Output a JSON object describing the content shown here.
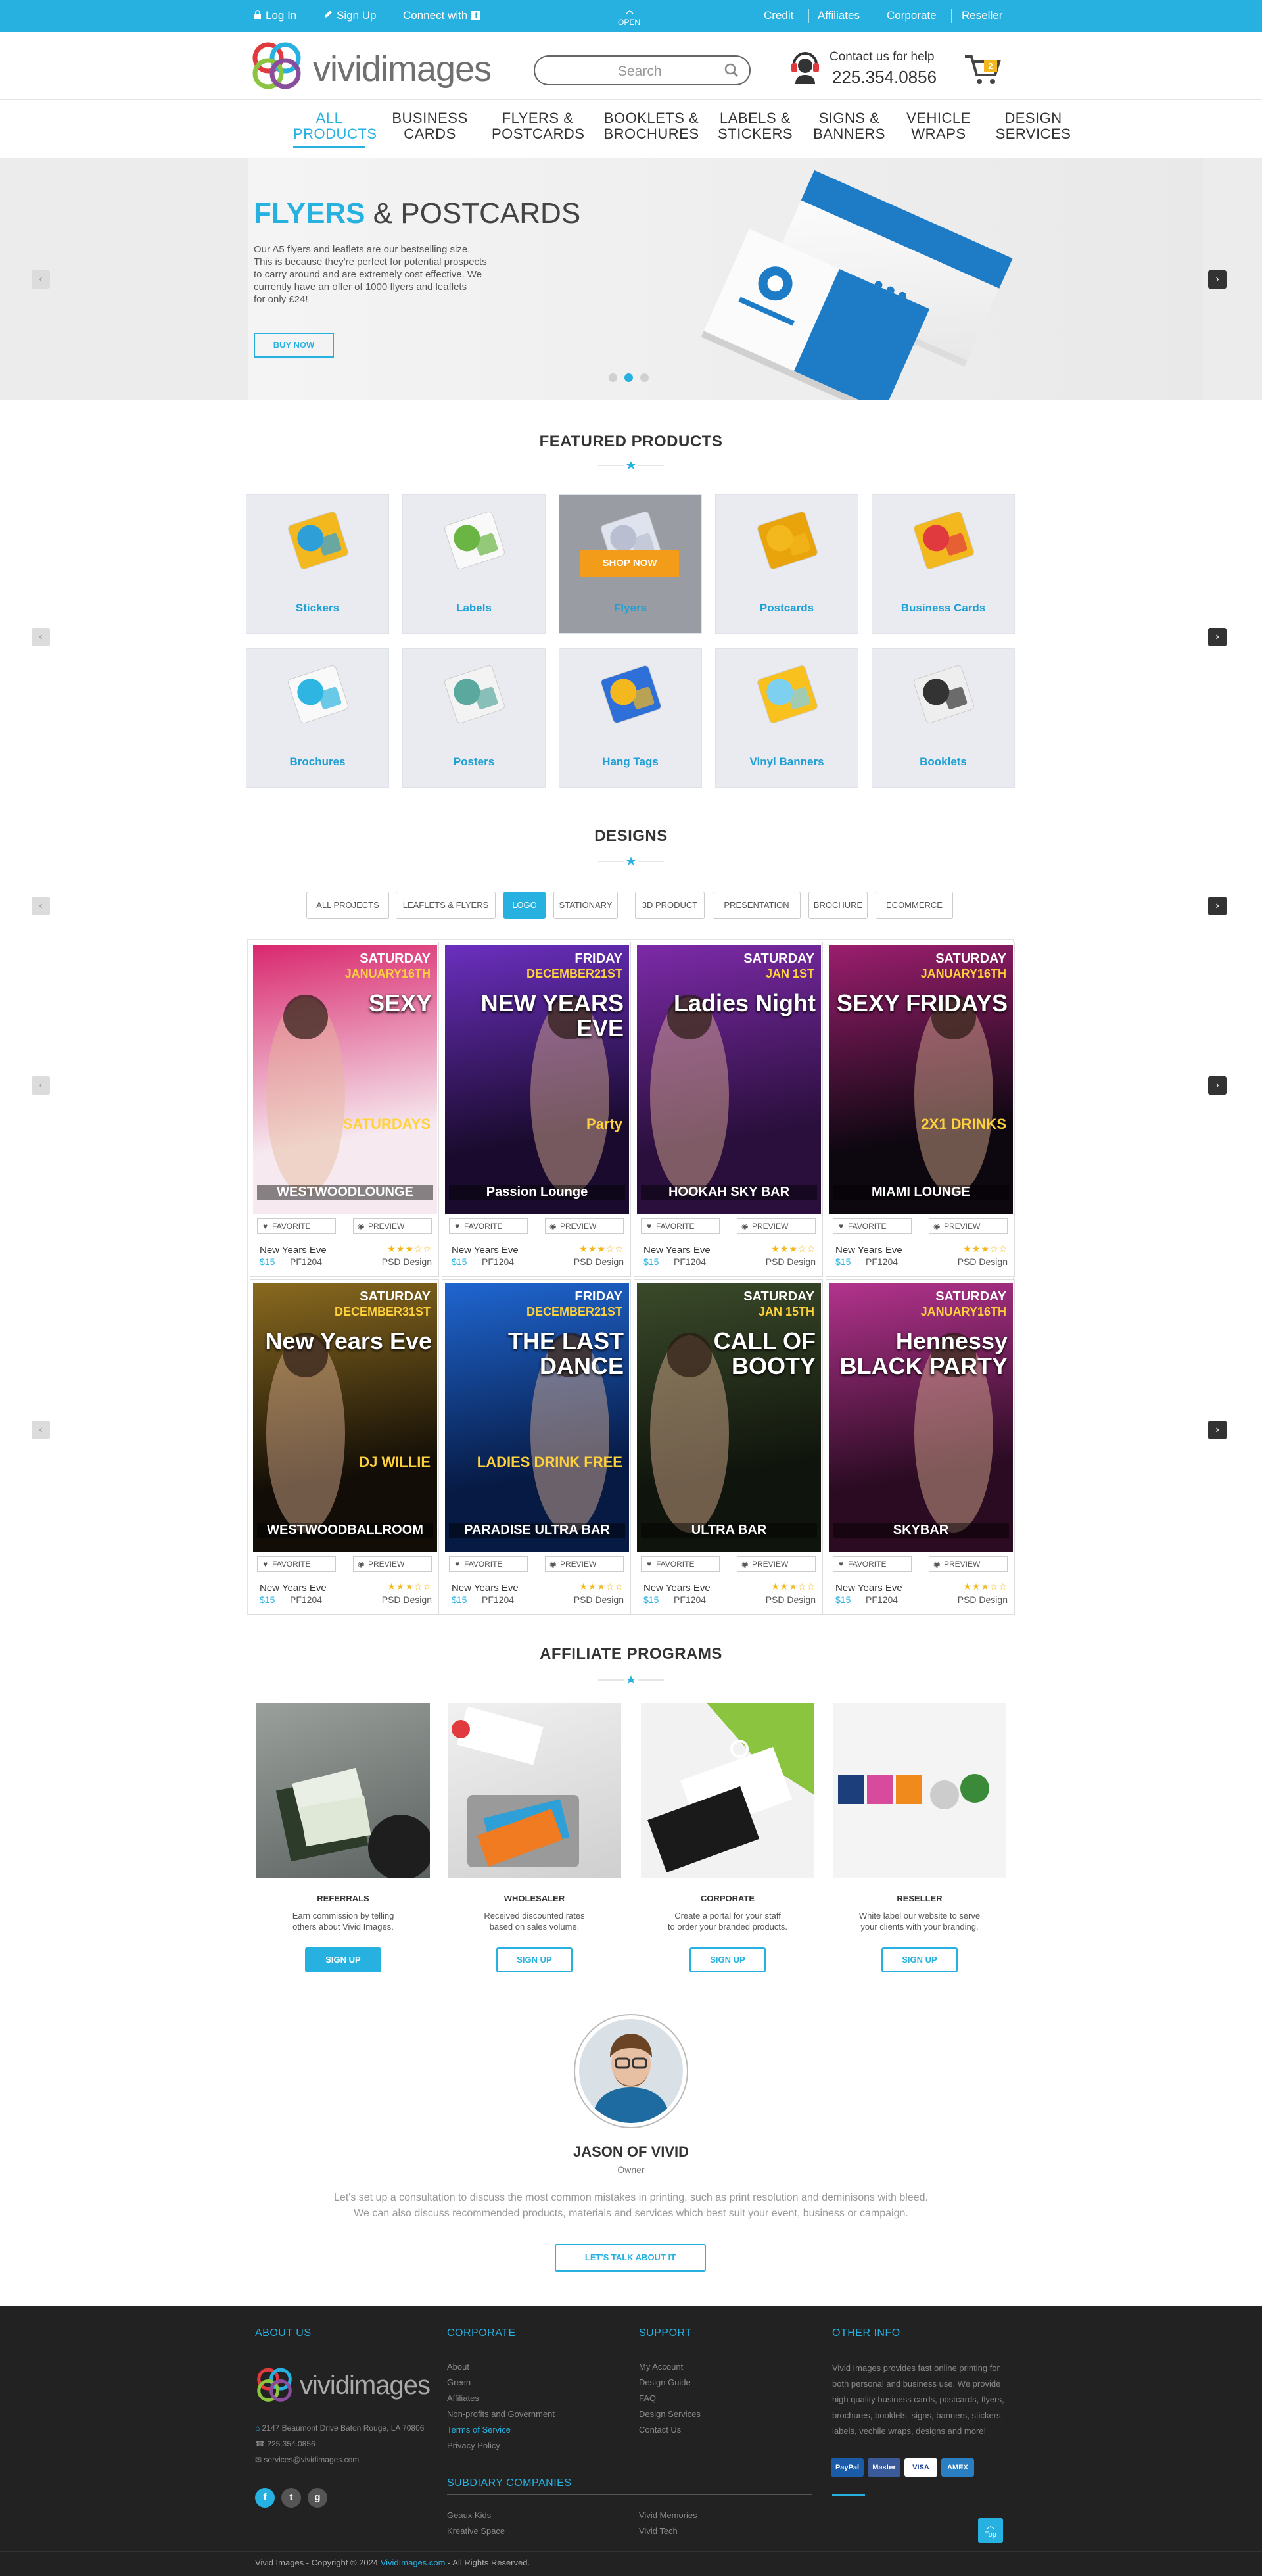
{
  "topbar": {
    "login": "Log In",
    "signup": "Sign Up",
    "connect": "Connect with",
    "open_tab": "OPEN",
    "links": [
      "Credit",
      "Affiliates",
      "Corporate",
      "Reseller"
    ]
  },
  "header": {
    "logo_text": "vividimages",
    "search_placeholder": "Search",
    "contact_label": "Contact us for help",
    "phone": "225.354.0856",
    "cart_count": "2"
  },
  "nav": [
    {
      "line1": "ALL",
      "line2": "PRODUCTS",
      "active": true
    },
    {
      "line1": "BUSINESS",
      "line2": "CARDS"
    },
    {
      "line1": "FLYERS &",
      "line2": "POSTCARDS"
    },
    {
      "line1": "BOOKLETS &",
      "line2": "BROCHURES"
    },
    {
      "line1": "LABELS &",
      "line2": "STICKERS"
    },
    {
      "line1": "SIGNS &",
      "line2": "BANNERS"
    },
    {
      "line1": "VEHICLE",
      "line2": "WRAPS"
    },
    {
      "line1": "DESIGN",
      "line2": "SERVICES"
    }
  ],
  "hero": {
    "title_bold": "FLYERS",
    "title_light": "& POSTCARDS",
    "body_lines": [
      "Our A5 flyers and leaflets are our bestselling size.",
      "This is because they're perfect for potential prospects",
      "to carry around and are extremely cost effective. We",
      "currently have an offer of 1000 flyers and leaflets",
      "for only £24!"
    ],
    "cta": "BUY NOW",
    "slides": 3,
    "active_slide": 2
  },
  "featured": {
    "title": "FEATURED PRODUCTS",
    "shop_now": "SHOP NOW",
    "items": [
      "Stickers",
      "Labels",
      "Flyers",
      "Postcards",
      "Business Cards",
      "Brochures",
      "Posters",
      "Hang Tags",
      "Vinyl Banners",
      "Booklets"
    ]
  },
  "designs": {
    "title": "DESIGNS",
    "filters": [
      "ALL PROJECTS",
      "LEAFLETS & FLYERS",
      "LOGO",
      "STATIONARY",
      "3D PRODUCT",
      "PRESENTATION",
      "BROCHURE",
      "ECOMMERCE"
    ],
    "active_filter": "LOGO",
    "favorite_label": "FAVORITE",
    "preview_label": "PREVIEW",
    "cards": [
      {
        "name": "New Years Eve",
        "price": "$15",
        "code": "PF1204",
        "type": "PSD Design",
        "poster": {
          "top": "SATURDAY",
          "mid": "JANUARY16TH",
          "big": "SEXY",
          "sub": "SATURDAYS",
          "foot": "WESTWOODLOUNGE",
          "c1": "#f6e9ef",
          "c2": "#d9286e"
        }
      },
      {
        "name": "New Years Eve",
        "price": "$15",
        "code": "PF1204",
        "type": "PSD Design",
        "poster": {
          "top": "FRIDAY",
          "mid": "DECEMBER21ST",
          "big": "NEW YEARS EVE",
          "sub": "Party",
          "foot": "Passion Lounge",
          "c1": "#1a0b2e",
          "c2": "#6b2fbf"
        }
      },
      {
        "name": "New Years Eve",
        "price": "$15",
        "code": "PF1204",
        "type": "PSD Design",
        "poster": {
          "top": "SATURDAY",
          "mid": "JAN 1ST",
          "big": "Ladies Night",
          "sub": "",
          "foot": "HOOKAH SKY BAR",
          "c1": "#2a0f3c",
          "c2": "#7c2aa8"
        }
      },
      {
        "name": "New Years Eve",
        "price": "$15",
        "code": "PF1204",
        "type": "PSD Design",
        "poster": {
          "top": "SATURDAY",
          "mid": "JANUARY16TH",
          "big": "SEXY FRIDAYS",
          "sub": "2X1 DRINKS",
          "foot": "MIAMI LOUNGE",
          "c1": "#0d0710",
          "c2": "#9b1e6e"
        }
      },
      {
        "name": "New Years Eve",
        "price": "$15",
        "code": "PF1204",
        "type": "PSD Design",
        "poster": {
          "top": "SATURDAY",
          "mid": "DECEMBER31ST",
          "big": "New Years Eve",
          "sub": "DJ WILLIE",
          "foot": "WESTWOODBALLROOM",
          "c1": "#120d06",
          "c2": "#8a6a1f"
        }
      },
      {
        "name": "New Years Eve",
        "price": "$15",
        "code": "PF1204",
        "type": "PSD Design",
        "poster": {
          "top": "FRIDAY",
          "mid": "DECEMBER21ST",
          "big": "THE LAST DANCE",
          "sub": "LADIES DRINK FREE",
          "foot": "PARADISE ULTRA BAR",
          "c1": "#071a44",
          "c2": "#1f66d1"
        }
      },
      {
        "name": "New Years Eve",
        "price": "$15",
        "code": "PF1204",
        "type": "PSD Design",
        "poster": {
          "top": "SATURDAY",
          "mid": "JAN 15TH",
          "big": "CALL OF BOOTY",
          "sub": "",
          "foot": "ULTRA BAR",
          "c1": "#0f140c",
          "c2": "#3b4a2a"
        }
      },
      {
        "name": "New Years Eve",
        "price": "$15",
        "code": "PF1204",
        "type": "PSD Design",
        "poster": {
          "top": "SATURDAY",
          "mid": "JANUARY16TH",
          "big": "Hennessy BLACK PARTY",
          "sub": "",
          "foot": "SKYBAR",
          "c1": "#2a0b22",
          "c2": "#b3338d"
        }
      }
    ]
  },
  "affiliates": {
    "title": "AFFILIATE PROGRAMS",
    "items": [
      {
        "title": "REFERRALS",
        "desc1": "Earn commission by telling",
        "desc2": "others about Vivid Images.",
        "btn": "SIGN UP"
      },
      {
        "title": "WHOLESALER",
        "desc1": "Received discounted rates",
        "desc2": "based on sales volume.",
        "btn": "SIGN UP"
      },
      {
        "title": "CORPORATE",
        "desc1": "Create a portal for your staff",
        "desc2": "to order your branded products.",
        "btn": "SIGN UP"
      },
      {
        "title": "RESELLER",
        "desc1": "White label our website to serve",
        "desc2": "your clients with your branding.",
        "btn": "SIGN UP"
      }
    ]
  },
  "owner": {
    "name": "JASON OF VIVID",
    "role": "Owner",
    "line1": "Let's set up a consultation to discuss the most common mistakes in printing, such as print resolution and deminisons with bleed.",
    "line2": "We can also discuss recommended products, materials and services which best suit your event, business or campaign.",
    "cta": "LET'S TALK ABOUT IT"
  },
  "footer": {
    "about": {
      "title": "ABOUT US",
      "address": "2147 Beaumont Drive  Baton Rouge, LA 70806",
      "phone": "225.354.0856",
      "email": "services@vividimages.com"
    },
    "corporate": {
      "title": "CORPORATE",
      "links": [
        "About",
        "Green",
        "Affiliates",
        "Non-profits and Government",
        "Terms of Service",
        "Privacy Policy"
      ]
    },
    "support": {
      "title": "SUPPORT",
      "links": [
        "My Account",
        "Design Guide",
        "FAQ",
        "Design Services",
        "Contact Us"
      ]
    },
    "other": {
      "title": "OTHER INFO",
      "lines": [
        "Vivid Images provides fast online printing for",
        "both personal and business use. We provide",
        "high quality business cards, postcards, flyers,",
        "brochures, booklets, signs, banners, stickers,",
        "labels, vechile wraps, designs and more!"
      ]
    },
    "subsidiary": {
      "title": "SUBDIARY COMPANIES",
      "col1": [
        "Geaux Kids",
        "Kreative Space"
      ],
      "col2": [
        "Vivid Memories",
        "Vivid Tech"
      ]
    },
    "payments": [
      "PayPal",
      "Master",
      "VISA",
      "AMEX"
    ],
    "top_label": "Top",
    "copyright_prefix": "Vivid Images - Copyright © 2024 ",
    "copyright_link": "VividImages.com",
    "copyright_suffix": " - All Rights Reserved."
  },
  "colors": {
    "accent": "#27b1e1",
    "footer_bg": "#222222",
    "dark": "#333333"
  }
}
